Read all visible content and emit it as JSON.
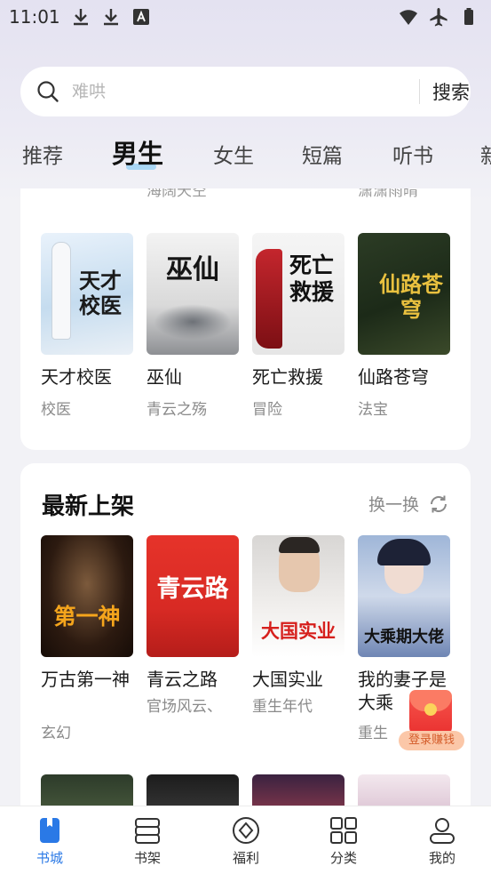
{
  "status_bar": {
    "time": "11:01",
    "left_icons": [
      "download-icon",
      "download-icon",
      "font-a-icon"
    ],
    "right_icons": [
      "wifi-icon",
      "airplane-mode-icon",
      "battery-icon"
    ]
  },
  "search": {
    "placeholder": "难哄",
    "button_label": "搜索"
  },
  "tabs": [
    {
      "label": "推荐",
      "active": false
    },
    {
      "label": "男生",
      "active": true
    },
    {
      "label": "女生",
      "active": false
    },
    {
      "label": "短篇",
      "active": false
    },
    {
      "label": "听书",
      "active": false
    },
    {
      "label": "新",
      "active": false
    }
  ],
  "section_1": {
    "partial_top_texts": [
      "海阔天空",
      "潇潇雨晴"
    ],
    "books": [
      {
        "title": "天才校医",
        "subtitle": "校医",
        "cover_text": "天才校医"
      },
      {
        "title": "巫仙",
        "subtitle": "青云之殇",
        "cover_text": "巫仙"
      },
      {
        "title": "死亡救援",
        "subtitle": "冒险",
        "cover_text": "死亡救援"
      },
      {
        "title": "仙路苍穹",
        "subtitle": "法宝",
        "cover_text": "仙路苍穹"
      }
    ]
  },
  "section_2": {
    "title": "最新上架",
    "refresh_label": "换一换",
    "books": [
      {
        "title": "万古第一神",
        "subtitle": "玄幻",
        "cover_text": "第一神"
      },
      {
        "title": "青云之路",
        "subtitle": "官场风云、",
        "cover_text": "青云路"
      },
      {
        "title": "大国实业",
        "subtitle": "重生年代",
        "cover_text": "大国实业"
      },
      {
        "title": "我的妻子是大乘",
        "subtitle": "重生",
        "cover_text": "大乘期大佬"
      }
    ]
  },
  "promo": {
    "label": "登录赚钱"
  },
  "bottom_nav": [
    {
      "label": "书城",
      "icon": "bookstore-icon",
      "active": true
    },
    {
      "label": "书架",
      "icon": "bookshelf-icon",
      "active": false
    },
    {
      "label": "福利",
      "icon": "welfare-icon",
      "active": false
    },
    {
      "label": "分类",
      "icon": "category-icon",
      "active": false
    },
    {
      "label": "我的",
      "icon": "profile-icon",
      "active": false
    }
  ],
  "colors": {
    "accent": "#2a79e6",
    "tab_underline": "#a9d6f5",
    "promo_red": "#e9302f"
  }
}
